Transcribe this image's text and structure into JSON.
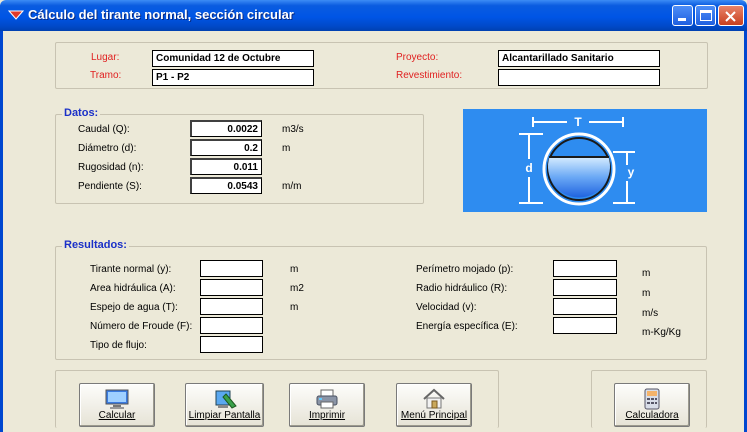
{
  "window": {
    "title": "Cálculo del tirante normal, sección circular"
  },
  "header": {
    "lugar_label": "Lugar:",
    "lugar_value": "Comunidad 12 de Octubre",
    "tramo_label": "Tramo:",
    "tramo_value": "P1   - P2",
    "proyecto_label": "Proyecto:",
    "proyecto_value": "Alcantarillado Sanitario",
    "revestimiento_label": "Revestimiento:",
    "revestimiento_value": ""
  },
  "datos": {
    "title": "Datos:",
    "caudal_label": "Caudal (Q):",
    "caudal_value": "0.0022",
    "caudal_unit": "m3/s",
    "diametro_label": "Diámetro (d):",
    "diametro_value": "0.2",
    "diametro_unit": "m",
    "rugosidad_label": "Rugosidad (n):",
    "rugosidad_value": "0.011",
    "pendiente_label": "Pendiente (S):",
    "pendiente_value": "0.0543",
    "pendiente_unit": "m/m"
  },
  "diagram": {
    "t_label": "T",
    "d_label": "d",
    "y_label": "y"
  },
  "resultados": {
    "title": "Resultados:",
    "tirante_label": "Tirante normal (y):",
    "tirante_unit": "m",
    "area_label": "Area hidráulica (A):",
    "area_unit": "m2",
    "espejo_label": "Espejo de agua (T):",
    "espejo_unit": "m",
    "froude_label": "Número de Froude (F):",
    "tipo_label": "Tipo de flujo:",
    "perimetro_label": "Perímetro mojado (p):",
    "perimetro_unit": "m",
    "radio_label": "Radio hidráulico (R):",
    "radio_unit": "m",
    "velocidad_label": "Velocidad (v):",
    "velocidad_unit": "m/s",
    "energia_label": "Energía específica (E):",
    "energia_unit": "m-Kg/Kg"
  },
  "buttons": {
    "calcular": "Calcular",
    "limpiar": "Limpiar Pantalla",
    "imprimir": "Imprimir",
    "menu": "Menú Principal",
    "calculadora": "Calculadora"
  }
}
